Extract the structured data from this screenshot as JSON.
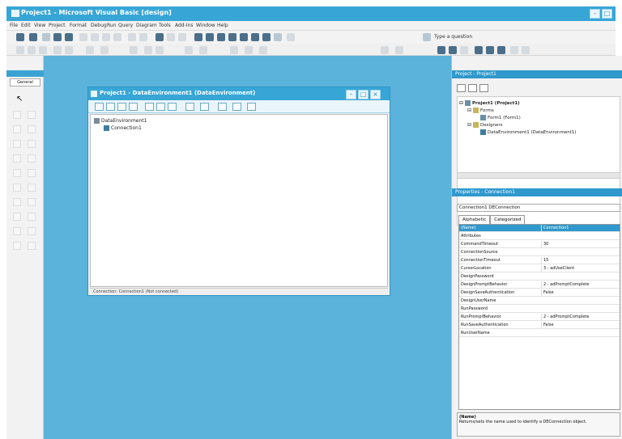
{
  "window": {
    "title": "Project1 - Microsoft Visual Basic [design]"
  },
  "menu": [
    "File",
    "Edit",
    "View",
    "Project",
    "Format",
    "Debug",
    "Run",
    "Query",
    "Diagram",
    "Tools",
    "Add-Ins",
    "Window",
    "Help"
  ],
  "toolbar": {
    "type_question": "Type a question"
  },
  "toolbox": {
    "tab": "General"
  },
  "designer": {
    "title": "Project1 - DataEnvironment1 (DataEnvironment)",
    "tree": [
      "DataEnvironment1",
      "Connection1"
    ],
    "status": "Connection: Connection1 (Not connected)"
  },
  "project_panel": {
    "title": "Project - Project1",
    "tree": [
      "Project1 (Project1)",
      "Forms",
      "Form1 (Form1)",
      "Designers",
      "DataEnvironment1 (DataEnvironment1)"
    ]
  },
  "properties_panel": {
    "title": "Properties - Connection1",
    "object": "Connection1  DEConnection",
    "tabs": [
      "Alphabetic",
      "Categorized"
    ],
    "rows": [
      {
        "name": "(Name)",
        "value": "Connection1"
      },
      {
        "name": "Attributes",
        "value": ""
      },
      {
        "name": "CommandTimeout",
        "value": "30"
      },
      {
        "name": "ConnectionSource",
        "value": ""
      },
      {
        "name": "ConnectionTimeout",
        "value": "15"
      },
      {
        "name": "CursorLocation",
        "value": "3 - adUseClient"
      },
      {
        "name": "DesignPassword",
        "value": ""
      },
      {
        "name": "DesignPromptBehavior",
        "value": "2 - adPromptComplete"
      },
      {
        "name": "DesignSaveAuthentication",
        "value": "False"
      },
      {
        "name": "DesignUserName",
        "value": ""
      },
      {
        "name": "RunPassword",
        "value": ""
      },
      {
        "name": "RunPromptBehavior",
        "value": "2 - adPromptComplete"
      },
      {
        "name": "RunSaveAuthentication",
        "value": "False"
      },
      {
        "name": "RunUserName",
        "value": ""
      }
    ],
    "desc_title": "(Name)",
    "desc_text": "Returns/sets the name used to identify a DEConnection object."
  }
}
